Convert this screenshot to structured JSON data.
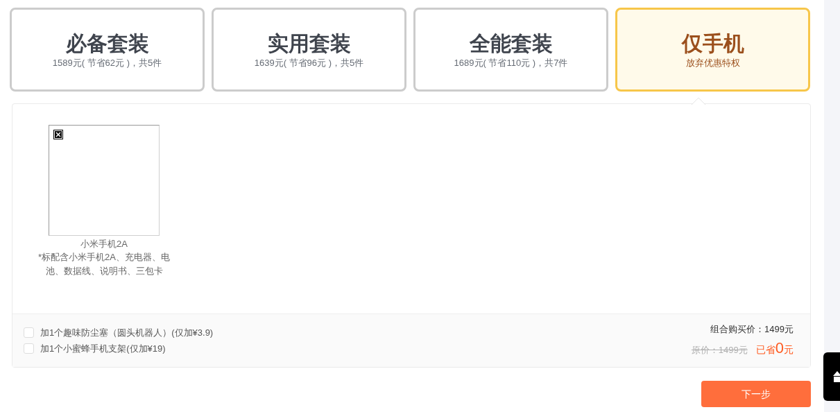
{
  "packages": [
    {
      "title": "必备套装",
      "subtitle": "1589元( 节省62元 )，共5件",
      "selected": false
    },
    {
      "title": "实用套装",
      "subtitle": "1639元( 节省96元 )，共5件",
      "selected": false
    },
    {
      "title": "全能套装",
      "subtitle": "1689元( 节省110元 )，共7件",
      "selected": false
    },
    {
      "title": "仅手机",
      "subtitle": "放弃优惠特权",
      "selected": true
    }
  ],
  "products": [
    {
      "name": "小米手机2A",
      "note": "*标配含小米手机2A、充电器、电池、数据线、说明书、三包卡"
    }
  ],
  "addons": [
    {
      "label": "加1个趣味防尘塞（圆头机器人）(仅加¥3.9)",
      "checked": false
    },
    {
      "label": "加1个小蜜蜂手机支架(仅加¥19)",
      "checked": false
    }
  ],
  "summary": {
    "combo_price": "组合购买价：1499元",
    "original_price": "原价：1499元",
    "saved_prefix": "已省",
    "saved_amount": "0",
    "saved_suffix": "元"
  },
  "next_button": "下一步"
}
